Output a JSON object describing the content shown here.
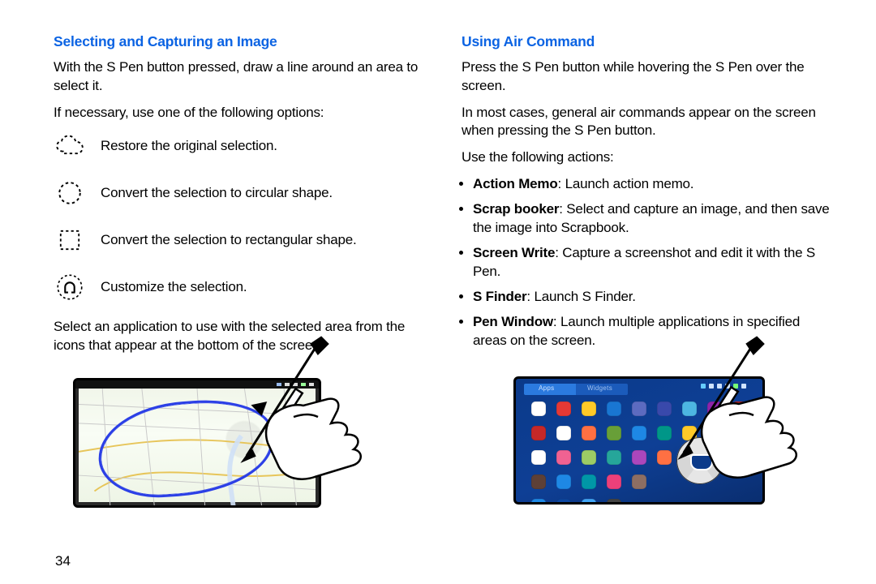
{
  "page_number": "34",
  "left": {
    "heading": "Selecting and Capturing an Image",
    "intro": "With the S Pen button pressed, draw a line around an area to select it.",
    "options_lead": "If necessary, use one of the following options:",
    "options": [
      "Restore the original selection.",
      "Convert the selection to circular shape.",
      "Convert the selection to rectangular shape.",
      "Customize the selection."
    ],
    "after_options": "Select an application to use with the selected area from the icons that appear at the bottom of the screen."
  },
  "right": {
    "heading": "Using Air Command",
    "p1": "Press the S Pen button while hovering the S Pen over the screen.",
    "p2": "In most cases, general air commands appear on the screen when pressing the S Pen button.",
    "actions_lead": "Use the following actions:",
    "actions": [
      {
        "name": "Action Memo",
        "desc": ": Launch action memo."
      },
      {
        "name": "Scrap booker",
        "desc": ": Select and capture an image, and then save the image into Scrapbook."
      },
      {
        "name": "Screen Write",
        "desc": ": Capture a screenshot and edit it with the S Pen."
      },
      {
        "name": "S Finder",
        "desc": ": Launch S Finder."
      },
      {
        "name": "Pen Window",
        "desc": ": Launch multiple applications in specified areas on the screen."
      }
    ]
  },
  "app_colors": [
    "#fff",
    "#e53935",
    "#ffca28",
    "#1976d2",
    "#5c6bc0",
    "#3949ab",
    "#4db6e2",
    "#8e24aa",
    "#c62828",
    "#c62828",
    "#ffffff",
    "#ff7043",
    "#689f38",
    "#1e88e5",
    "#009688",
    "#ffca28",
    "#424242",
    "#ef5350",
    "#ffffff",
    "#f06292",
    "#9ccc65",
    "#26a69a",
    "#ab47bc",
    "#ff7043",
    "#ffffff",
    "#5c6bc0",
    "#ef5350",
    "#5d4037",
    "#1e88e5",
    "#0097a7",
    "#ec407a",
    "#8d6e63",
    "#1e88e5",
    "#0d47a1",
    "#42a5f5",
    "#444"
  ]
}
